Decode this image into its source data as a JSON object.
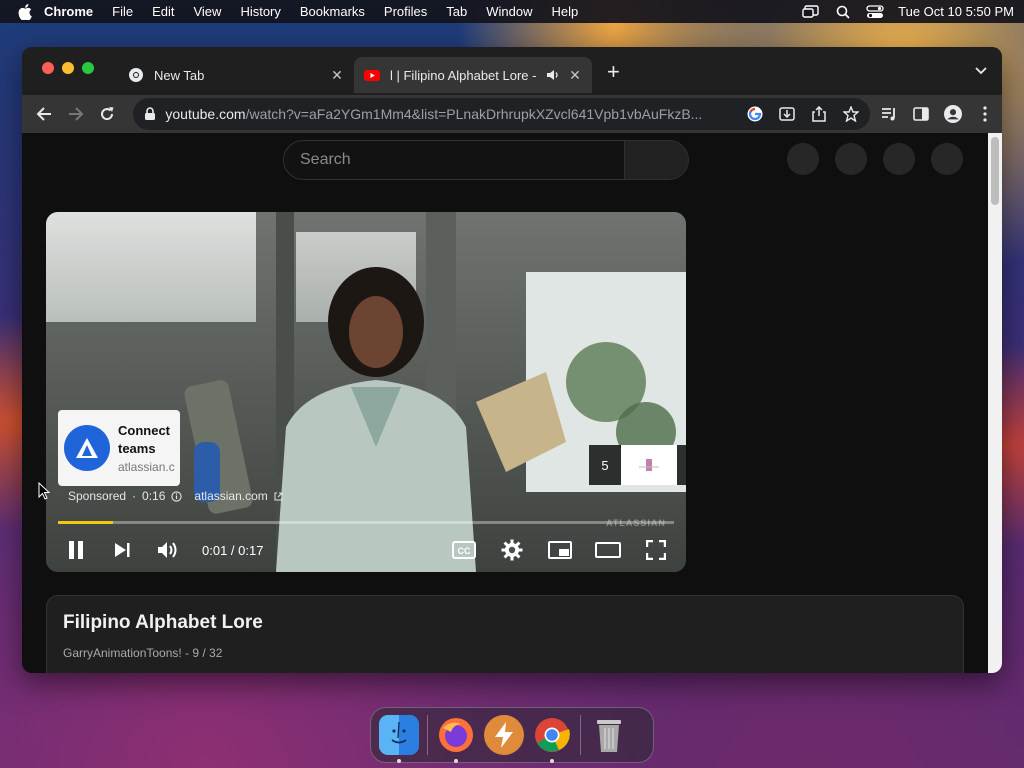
{
  "menubar": {
    "apple_icon": "apple-logo-icon",
    "items": [
      "Chrome",
      "File",
      "Edit",
      "View",
      "History",
      "Bookmarks",
      "Profiles",
      "Tab",
      "Window",
      "Help"
    ],
    "datetime": "Tue Oct 10  5:50 PM"
  },
  "browser": {
    "tabs": [
      {
        "title": "New Tab",
        "icon": "chrome-icon"
      },
      {
        "title": "l | Filipino Alphabet Lore -",
        "icon": "youtube-icon"
      }
    ],
    "url_host": "youtube.com",
    "url_path": "/watch?v=aFa2YGm1Mm4&list=PLnakDrhrupkXZvcl641Vpb1vbAuFkzB..."
  },
  "youtube": {
    "search_placeholder": "Search",
    "ad": {
      "headline": "Connect teams",
      "domain_short": "atlassian.c",
      "sponsored": "Sponsored",
      "remaining": "0:16",
      "domain": "atlassian.com",
      "skip_count": "5",
      "watermark": "ATLASSIAN"
    },
    "player": {
      "current_time": "0:01",
      "duration": "0:17",
      "time_display": "0:01 / 0:17",
      "progress_percent": 9
    },
    "video": {
      "title": "Filipino Alphabet Lore",
      "meta": "GarryAnimationToons! - 9 / 32"
    }
  },
  "colors": {
    "accent_progress": "#f5c518",
    "youtube_red": "#ff0000",
    "atlassian_blue": "#1f64d8"
  },
  "dock": {
    "apps": [
      "finder",
      "firefox",
      "reeder",
      "chrome",
      "trash"
    ]
  }
}
